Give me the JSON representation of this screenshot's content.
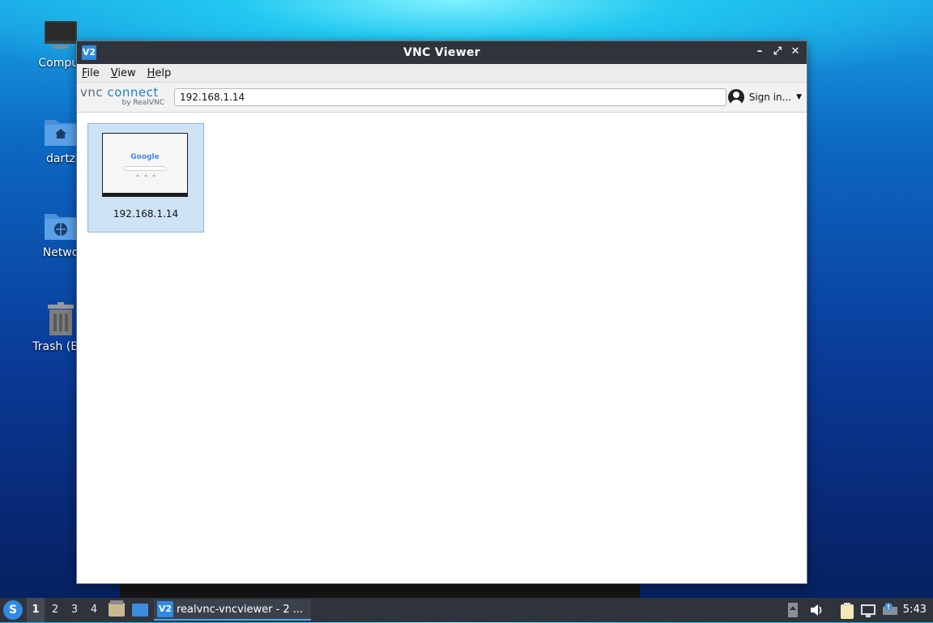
{
  "desktop": {
    "icons": [
      {
        "label": "Comput",
        "icon": "computer-icon"
      },
      {
        "label": "dartz",
        "icon": "home-folder-icon"
      },
      {
        "label": "Netwo",
        "icon": "network-folder-icon"
      },
      {
        "label": "Trash (Em",
        "icon": "trash-icon"
      }
    ]
  },
  "window": {
    "title": "VNC Viewer",
    "app_icon_text": "V2",
    "controls": {
      "minimize": "–",
      "restore": "⤢",
      "close": "✕"
    },
    "menu": [
      "File",
      "View",
      "Help"
    ],
    "logo": {
      "brand_a": "vnc",
      "brand_b": " connect",
      "sub": "by RealVNC"
    },
    "address": {
      "value": "192.168.1.14"
    },
    "sign_in": {
      "label": "Sign in...",
      "caret": "▼"
    },
    "connections": [
      {
        "label": "192.168.1.14",
        "thumbnail_text": "Google"
      }
    ]
  },
  "taskbar": {
    "start_icon_text": "S",
    "workspaces": [
      "1",
      "2",
      "3",
      "4"
    ],
    "active_workspace": "1",
    "task": {
      "icon_text": "V2",
      "label": "realvnc-vncviewer - 2 ..."
    },
    "clock": "5:43"
  },
  "colors": {
    "accent": "#2f8ae6",
    "titlebar": "#2f343c",
    "selection": "#cfe3f7"
  }
}
